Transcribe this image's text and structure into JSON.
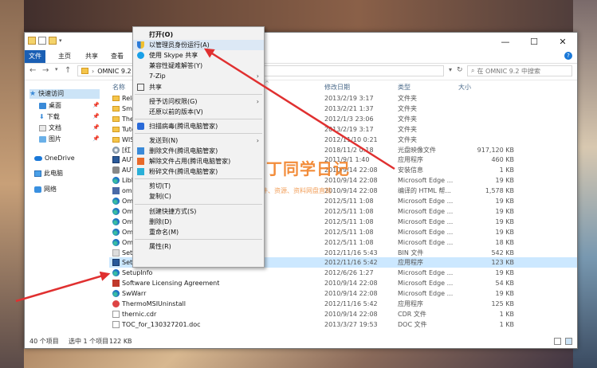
{
  "window": {
    "ribbon_tabs": [
      "文件",
      "主页",
      "共享",
      "查看"
    ],
    "address_path": "OMNIC 9.2",
    "search_placeholder": "在 OMNIC 9.2 中搜索",
    "help_icon": "help-icon"
  },
  "sidebar": {
    "items": [
      {
        "label": "快速访问",
        "icon": "star-icon"
      },
      {
        "label": "桌面",
        "icon": "desktop-icon"
      },
      {
        "label": "下载",
        "icon": "download-icon"
      },
      {
        "label": "文档",
        "icon": "document-icon"
      },
      {
        "label": "图片",
        "icon": "picture-icon"
      },
      {
        "label": "OneDrive",
        "icon": "cloud-icon"
      },
      {
        "label": "此电脑",
        "icon": "computer-icon"
      },
      {
        "label": "网络",
        "icon": "network-icon"
      }
    ]
  },
  "columns": {
    "name": "名称",
    "date": "修改日期",
    "type": "类型",
    "size": "大小"
  },
  "files": [
    {
      "name": "Relea",
      "date": "2013/2/19 3:17",
      "type": "文件夹",
      "size": "",
      "icon": "folder"
    },
    {
      "name": "Sma",
      "date": "2013/2/21 1:37",
      "type": "文件夹",
      "size": "",
      "icon": "folder"
    },
    {
      "name": "The",
      "date": "2012/1/3 23:06",
      "type": "文件夹",
      "size": "",
      "icon": "folder"
    },
    {
      "name": "Tuto",
      "date": "2013/2/19 3:17",
      "type": "文件夹",
      "size": "",
      "icon": "folder"
    },
    {
      "name": "WISE",
      "date": "2012/11/10 0:21",
      "type": "文件夹",
      "size": "",
      "icon": "folder"
    },
    {
      "name": "[红",
      "date": "2018/11/2 0:18",
      "type": "光盘映像文件",
      "size": "917,120 KB",
      "icon": "disc"
    },
    {
      "name": "AUT",
      "date": "2011/9/1 1:40",
      "type": "应用程序",
      "size": "460 KB",
      "icon": "app"
    },
    {
      "name": "AUT",
      "date": "2010/9/14 22:08",
      "type": "安装信息",
      "size": "1 KB",
      "icon": "gear"
    },
    {
      "name": "Libl",
      "date": "2010/9/14 22:08",
      "type": "Microsoft Edge ...",
      "size": "19 KB",
      "icon": "edge"
    },
    {
      "name": "omi",
      "date": "2010/9/14 22:08",
      "type": "编译的 HTML 帮...",
      "size": "1,578 KB",
      "icon": "help"
    },
    {
      "name": "Om",
      "date": "2012/5/11 1:08",
      "type": "Microsoft Edge ...",
      "size": "19 KB",
      "icon": "edge"
    },
    {
      "name": "Om",
      "date": "2012/5/11 1:08",
      "type": "Microsoft Edge ...",
      "size": "19 KB",
      "icon": "edge"
    },
    {
      "name": "Om",
      "date": "2012/5/11 1:08",
      "type": "Microsoft Edge ...",
      "size": "19 KB",
      "icon": "edge"
    },
    {
      "name": "Om",
      "date": "2012/5/11 1:08",
      "type": "Microsoft Edge ...",
      "size": "19 KB",
      "icon": "edge"
    },
    {
      "name": "Om",
      "date": "2012/5/11 1:08",
      "type": "Microsoft Edge ...",
      "size": "18 KB",
      "icon": "edge"
    },
    {
      "name": "Setu",
      "date": "2012/11/16 5:43",
      "type": "BIN 文件",
      "size": "542 KB",
      "icon": "bin"
    },
    {
      "name": "Setup",
      "date": "2012/11/16 5:42",
      "type": "应用程序",
      "size": "123 KB",
      "icon": "app",
      "selected": true
    },
    {
      "name": "SetupInfo",
      "date": "2012/6/26 1:27",
      "type": "Microsoft Edge ...",
      "size": "19 KB",
      "icon": "edge"
    },
    {
      "name": "Software Licensing Agreement",
      "date": "2010/9/14 22:08",
      "type": "Microsoft Edge ...",
      "size": "54 KB",
      "icon": "pdf"
    },
    {
      "name": "SwWarr",
      "date": "2010/9/14 22:08",
      "type": "Microsoft Edge ...",
      "size": "19 KB",
      "icon": "edge"
    },
    {
      "name": "ThermoMSIUninstall",
      "date": "2012/11/16 5:42",
      "type": "应用程序",
      "size": "125 KB",
      "icon": "red"
    },
    {
      "name": "thernic.cdr",
      "date": "2010/9/14 22:08",
      "type": "CDR 文件",
      "size": "1 KB",
      "icon": "doc"
    },
    {
      "name": "TOC_for_130327201.doc",
      "date": "2013/3/27 19:53",
      "type": "DOC 文件",
      "size": "1 KB",
      "icon": "doc"
    }
  ],
  "status": {
    "count": "40 个项目",
    "selected": "选中 1 个项目",
    "size": "122 KB"
  },
  "context_menu": {
    "items": [
      {
        "label": "打开(O)",
        "bold": true
      },
      {
        "label": "以管理员身份运行(A)",
        "icon": "shield",
        "highlight": true
      },
      {
        "label": "使用 Skype 共享",
        "icon": "skype"
      },
      {
        "label": "兼容性疑难解答(Y)"
      },
      {
        "label": "7-Zip",
        "arrow": true
      },
      {
        "label": "共享",
        "icon": "share"
      },
      {
        "sep": true
      },
      {
        "label": "授予访问权限(G)",
        "arrow": true
      },
      {
        "label": "还原以前的版本(V)"
      },
      {
        "sep": true
      },
      {
        "label": "扫描病毒(腾讯电脑管家)",
        "icon": "scan"
      },
      {
        "sep": true
      },
      {
        "label": "发送到(N)",
        "arrow": true
      },
      {
        "label": "删除文件(腾讯电脑管家)",
        "icon": "tx"
      },
      {
        "label": "解除文件占用(腾讯电脑管家)",
        "icon": "tx2"
      },
      {
        "label": "粉碎文件(腾讯电脑管家)",
        "icon": "tx3"
      },
      {
        "sep": true
      },
      {
        "label": "剪切(T)"
      },
      {
        "label": "复制(C)"
      },
      {
        "sep": true
      },
      {
        "label": "创建快捷方式(S)"
      },
      {
        "label": "删除(D)"
      },
      {
        "label": "重命名(M)"
      },
      {
        "sep": true
      },
      {
        "label": "属性(R)"
      }
    ]
  },
  "watermark": {
    "main": "丁同学日记",
    "sub": "软件、资源、资料网盘直链"
  },
  "colors": {
    "accent": "#1a5fb4",
    "selection": "#cce8ff",
    "arrow": "#e03030",
    "watermark": "#f07818"
  }
}
